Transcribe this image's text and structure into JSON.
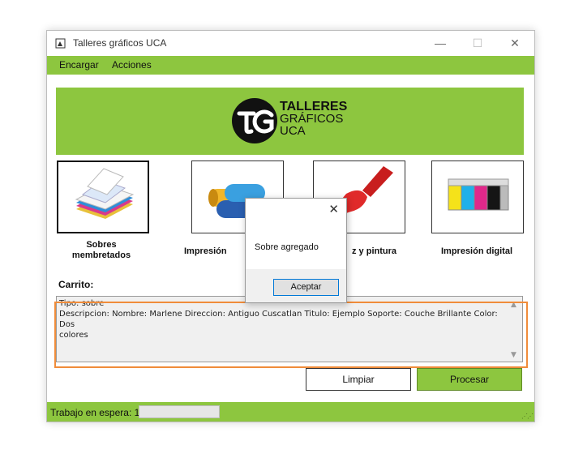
{
  "window": {
    "title": "Talleres gráficos UCA",
    "controls": {
      "minimize": "—",
      "maximize": "☐",
      "close": "✕"
    }
  },
  "menu": [
    {
      "label": "Encargar"
    },
    {
      "label": "Acciones"
    }
  ],
  "logo": {
    "mark": "UG",
    "line1": "TALLERES",
    "line2": "GRÁFICOS",
    "line3": "UCA"
  },
  "products": [
    {
      "label_line1": "Sobres",
      "label_line2": "membretados",
      "selected": true,
      "icon": "envelope-stack-icon"
    },
    {
      "label": "Impresión",
      "icon": "paint-rollers-icon"
    },
    {
      "label": "z y pintura",
      "icon": "paint-brush-icon"
    },
    {
      "label": "Impresión digital",
      "icon": "ink-cartridges-icon"
    }
  ],
  "cart": {
    "label": "Carrito:",
    "lines": [
      "Tipo: sobre",
      "Descripcion: Nombre: Marlene Direccion: Antiguo Cuscatlan Titulo: Ejemplo Soporte: Couche Brillante Color: Dos",
      "colores"
    ]
  },
  "buttons": {
    "clear": "Limpiar",
    "process": "Procesar"
  },
  "status": {
    "text": "Trabajo en espera: 1",
    "progress": 0
  },
  "dialog": {
    "message": "Sobre agregado",
    "ok": "Aceptar",
    "close": "✕"
  },
  "colors": {
    "accent": "#8dc63f",
    "focus": "#f08c3a",
    "process_button": "#8dc63f"
  }
}
